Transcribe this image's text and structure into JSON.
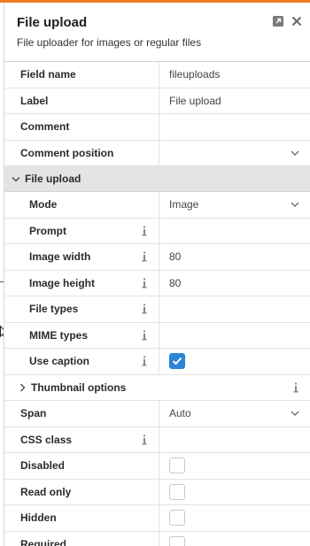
{
  "header": {
    "title": "File upload",
    "subtitle": "File uploader for images or regular files",
    "popout_icon": "popout-icon",
    "close_icon": "close-icon"
  },
  "rows_top": [
    {
      "label": "Field name",
      "value": "fileuploads"
    },
    {
      "label": "Label",
      "value": "File upload"
    },
    {
      "label": "Comment",
      "value": ""
    },
    {
      "label": "Comment position",
      "value": "",
      "dropdown": true
    }
  ],
  "section": {
    "label": "File upload",
    "expanded": true
  },
  "section_rows": [
    {
      "label": "Mode",
      "value": "Image",
      "dropdown": true
    },
    {
      "label": "Prompt",
      "value": "",
      "info": true
    },
    {
      "label": "Image width",
      "value": "80",
      "info": true
    },
    {
      "label": "Image height",
      "value": "80",
      "info": true
    },
    {
      "label": "File types",
      "value": "",
      "info": true
    },
    {
      "label": "MIME types",
      "value": "",
      "info": true
    },
    {
      "label": "Use caption",
      "checked": true,
      "info": true
    }
  ],
  "group": {
    "label": "Thumbnail options",
    "expanded": false
  },
  "rows_bottom": [
    {
      "label": "Span",
      "value": "Auto",
      "dropdown": true
    },
    {
      "label": "CSS class",
      "value": "",
      "info": true
    },
    {
      "label": "Disabled",
      "checked": false
    },
    {
      "label": "Read only",
      "checked": false
    },
    {
      "label": "Hidden",
      "checked": false
    },
    {
      "label": "Required",
      "checked": false
    }
  ],
  "colors": {
    "accent": "#f07d22",
    "checkbox_checked": "#2b84d6",
    "section_bg": "#e4e4e4"
  }
}
